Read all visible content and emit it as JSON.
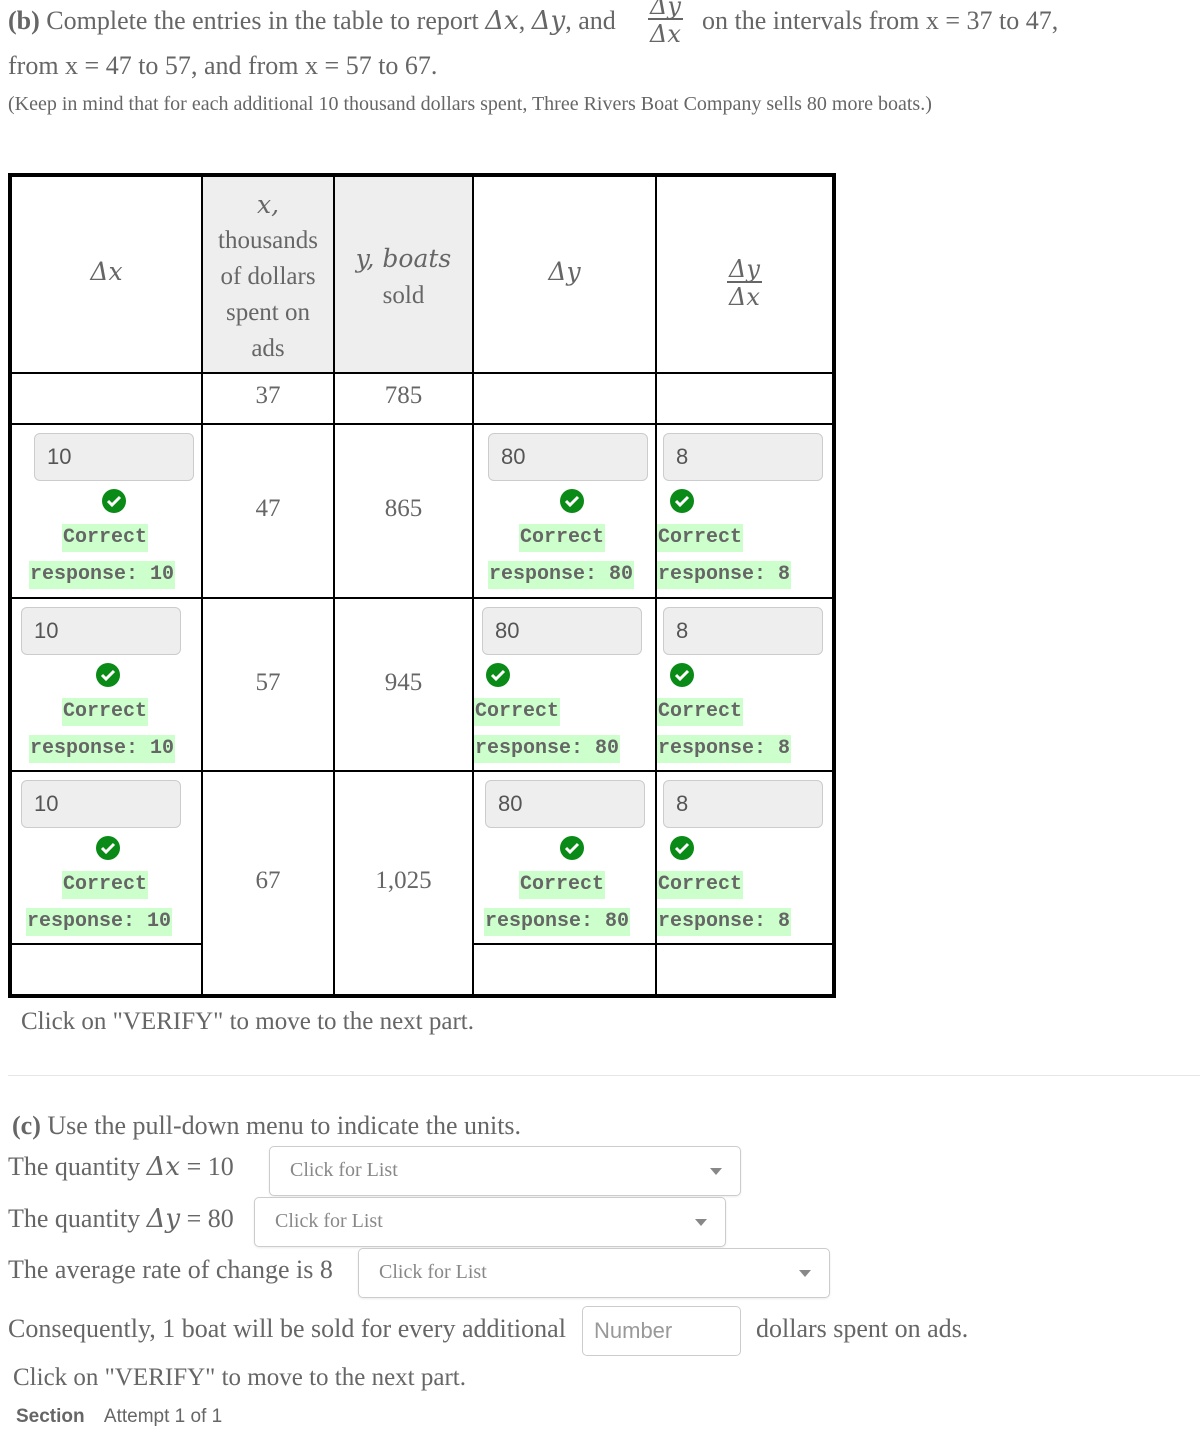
{
  "part_b": {
    "label": "(b)",
    "intro_text_1": " Complete the entries in the table to report ",
    "delta_x": "Δx",
    "comma_1": ", ",
    "delta_y": "Δy",
    "and_text": ", and ",
    "frac_num": "Δy",
    "frac_den": "Δx",
    "intro_text_2": " on the intervals from ",
    "interval_1": "x = 37 to 47,",
    "line2_from": "from ",
    "interval_2": "x = 47 to 57",
    "line2_mid": ", and from ",
    "interval_3": "x = 57 to 67",
    "line2_end": ".",
    "note": "(Keep in mind that for each additional 10 thousand dollars spent, Three Rivers Boat Company sells 80 more boats.)",
    "verify_hint": "Click on \"VERIFY\" to move to the next part."
  },
  "table": {
    "headers": {
      "delta_x": "Δx",
      "x_line1": "x,",
      "x_line2": "thousands",
      "x_line3": "of dollars",
      "x_line4": "spent on",
      "x_line5": "ads",
      "y_line1": "y, boats",
      "y_line2": "sold",
      "delta_y": "Δy",
      "ratio_num": "Δy",
      "ratio_den": "Δx"
    },
    "x_values": [
      "37",
      "47",
      "57",
      "67"
    ],
    "y_values": [
      "785",
      "865",
      "945",
      "1,025"
    ],
    "intervals": [
      {
        "delta_x": {
          "value": "10",
          "feedback_1": "Correct",
          "feedback_2": "response: 10",
          "status": "correct"
        },
        "delta_y": {
          "value": "80",
          "feedback_1": "Correct",
          "feedback_2": "response: 80",
          "status": "correct"
        },
        "ratio": {
          "value": "8",
          "feedback_1": "Correct",
          "feedback_2": "response: 8",
          "status": "correct"
        }
      },
      {
        "delta_x": {
          "value": "10",
          "feedback_1": "Correct",
          "feedback_2": "response: 10",
          "status": "correct"
        },
        "delta_y": {
          "value": "80",
          "feedback_1": "Correct",
          "feedback_2": "response: 80",
          "status": "correct"
        },
        "ratio": {
          "value": "8",
          "feedback_1": "Correct",
          "feedback_2": "response: 8",
          "status": "correct"
        }
      },
      {
        "delta_x": {
          "value": "10",
          "feedback_1": "Correct",
          "feedback_2": "response: 10",
          "status": "correct"
        },
        "delta_y": {
          "value": "80",
          "feedback_1": "Correct",
          "feedback_2": "response: 80",
          "status": "correct"
        },
        "ratio": {
          "value": "8",
          "feedback_1": "Correct",
          "feedback_2": "response: 8",
          "status": "correct"
        }
      }
    ]
  },
  "part_c": {
    "label": "(c)",
    "title": " Use the pull-down menu to indicate the units.",
    "q1_prefix": "The quantity ",
    "q1_var": "Δx",
    "q1_eq": " = ",
    "q1_value": "10",
    "q2_prefix": "The quantity ",
    "q2_var": "Δy",
    "q2_eq": " = 80",
    "q3_text": "The average rate of change is 8",
    "dropdown_placeholder": "Click for List",
    "q4_prefix": "Consequently, 1 boat will be sold for every additional",
    "number_placeholder": "Number",
    "q4_suffix": "dollars spent on ads.",
    "verify_hint": "Click on \"VERIFY\" to move to the next part."
  },
  "footer": {
    "section_label": "Section",
    "attempt_text": "Attempt 1 of 1"
  },
  "colors": {
    "correct_green": "#0a8a16",
    "feedback_bg": "#ccffcc",
    "text_gray": "#666666",
    "header_shade": "#eeeeee"
  }
}
